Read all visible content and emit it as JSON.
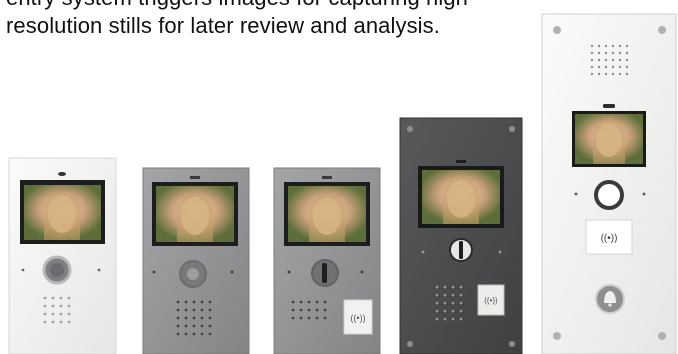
{
  "caption": {
    "line1": "entry system triggers images for capturing high",
    "line2": "resolution stills for later review and analysis."
  },
  "panels": [
    {
      "name": "white-slim-panel",
      "finish": "white",
      "features": [
        "camera",
        "screen",
        "button",
        "speaker"
      ]
    },
    {
      "name": "grey-panel",
      "finish": "grey",
      "features": [
        "camera",
        "screen",
        "button",
        "speaker"
      ]
    },
    {
      "name": "grey-panel-with-reader",
      "finish": "grey",
      "features": [
        "camera",
        "screen",
        "button",
        "speaker",
        "proximity-reader"
      ]
    },
    {
      "name": "dark-panel-with-reader",
      "finish": "dark-grey",
      "features": [
        "camera",
        "screen",
        "button",
        "speaker",
        "proximity-reader"
      ]
    },
    {
      "name": "tall-white-panel",
      "finish": "white",
      "features": [
        "speaker",
        "camera",
        "screen",
        "button",
        "proximity-reader",
        "bell-button"
      ]
    }
  ],
  "reader_symbol": "((•))",
  "colors": {
    "white_panel": "#f2f2f0",
    "grey_panel": "#8f9193",
    "dark_panel": "#4a4b4d",
    "text": "#111111"
  }
}
